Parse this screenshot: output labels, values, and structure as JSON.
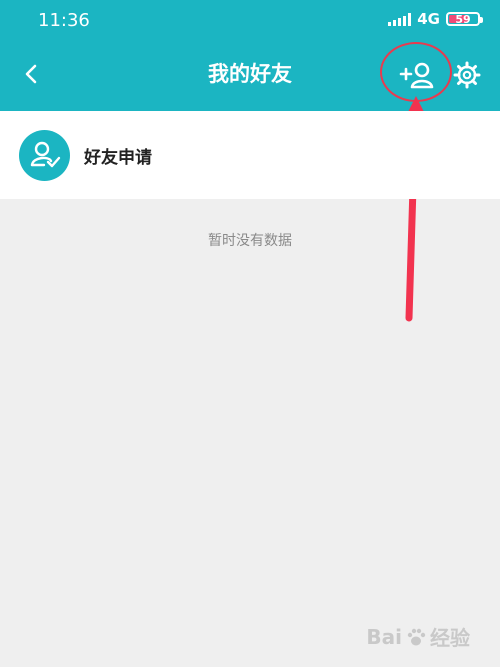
{
  "status_bar": {
    "time": "11:36",
    "network": "4G",
    "battery_level": "59"
  },
  "header": {
    "title": "我的好友"
  },
  "friend_request": {
    "label": "好友申请"
  },
  "empty_state": {
    "text": "暂时没有数据"
  },
  "watermark": {
    "brand": "Bai",
    "suffix": "经验"
  },
  "icons": {
    "back": "chevron-left-icon",
    "add_friend": "add-user-icon",
    "settings": "gear-icon",
    "request_avatar": "user-check-icon"
  },
  "colors": {
    "header_bg": "#1bb5c2",
    "accent": "#1bb5c2",
    "annotation": "#f2334f",
    "page_bg": "#efefef"
  }
}
